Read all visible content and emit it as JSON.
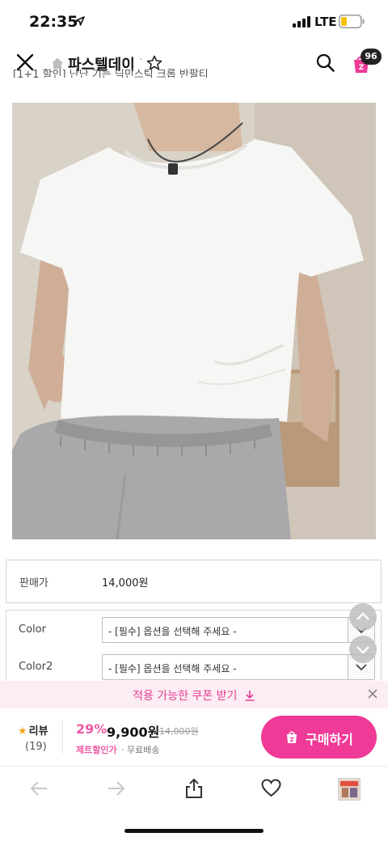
{
  "status_bar": {
    "time": "22:35",
    "network": "LTE",
    "icons": [
      "location-arrow-icon",
      "cellular-signal-icon",
      "battery-icon"
    ]
  },
  "nav": {
    "shop_name": "파스텔데이",
    "separator": "·",
    "cart_count": "96",
    "icons": [
      "close-icon",
      "home-icon",
      "star-outline-icon",
      "search-icon",
      "cart-icon"
    ]
  },
  "product": {
    "cut_title": "[1+1 할인] 난난 기는 딕민스틱 크롭 반팔티",
    "image_desc": "white-crop-t-shirt-photo"
  },
  "price_table": {
    "label": "판매가",
    "value": "14,000원"
  },
  "options": [
    {
      "label": "Color",
      "placeholder": "- [필수] 옵션을 선택해 주세요 -"
    },
    {
      "label": "Color2",
      "placeholder": "- [필수] 옵션을 선택해 주세요 -"
    }
  ],
  "coupon_bar": {
    "text": "적용 가능한 쿠폰 받기"
  },
  "purchase_bar": {
    "review_label": "리뷰",
    "review_count": "(19)",
    "discount_percent": "29%",
    "sale_price": "9,900원",
    "original_price": "14,000원",
    "zeta_label": "제트할인가",
    "shipping": "· 무료배송",
    "buy_label": "구매하기"
  },
  "colors": {
    "accent_pink": "#ef3a97",
    "coupon_bg": "#fcecf3",
    "discount_pink": "#ef5aa5",
    "review_star": "#f1a31a"
  }
}
